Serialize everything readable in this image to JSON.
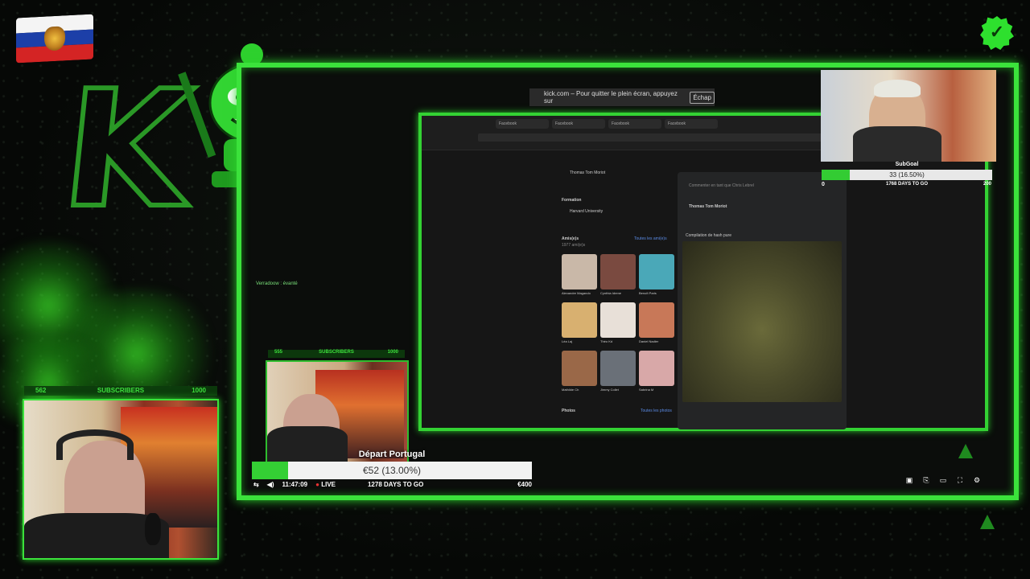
{
  "overlay": {
    "top_right_badge": "check-badge-icon",
    "accent_color": "#3be23b"
  },
  "fullscreen_toast": {
    "text": "kick.com – Pour quitter le plein écran, appuyez sur",
    "key": "Échap"
  },
  "subgoal": {
    "label": "SubGoal",
    "progress_text": "33 (16.50%)",
    "progress_fraction": 0.165,
    "min": "0",
    "max": "200",
    "days_text": "1768 DAYS TO GO"
  },
  "subscribers_main": {
    "current": "562",
    "label": "SUBSCRIBERS",
    "target": "1000"
  },
  "subscribers_inner": {
    "current": "555",
    "label": "SUBSCRIBERS",
    "target": "1000"
  },
  "donation_goal": {
    "title": "Départ Portugal",
    "progress_text": "€52 (13.00%)",
    "progress_fraction": 0.13,
    "days_text": "1278 DAYS TO GO",
    "target": "€400"
  },
  "player": {
    "time": "11:47:09",
    "live_label": "LIVE"
  },
  "facebook": {
    "profile_name": "Thomas Tom Moriot",
    "education_heading": "Formation",
    "education_item": "Harvard University",
    "friends_heading": "Amis(e)s",
    "friends_count": "1977 ami(e)s",
    "see_all": "Toutes les ami(e)s",
    "photos_heading": "Photos",
    "photos_link": "Toutes les photos",
    "friends": [
      {
        "name": "Alexandre Magando"
      },
      {
        "name": "Cynthia Idrene"
      },
      {
        "name": "Benoît Paris"
      },
      {
        "name": "Léa Laj"
      },
      {
        "name": "Théo Kd"
      },
      {
        "name": "Daniel Nadier"
      },
      {
        "name": "Mathilde Ch"
      },
      {
        "name": "Jimmy Collet"
      },
      {
        "name": "Sabrina M"
      }
    ],
    "post_author": "Thomas Tom Moriot",
    "post_caption": "Compilation de hash pure",
    "comment_placeholder": "Commenter en tant que Chris Lebrel"
  },
  "chat_lines": [
    "Verradoow : évanté"
  ]
}
